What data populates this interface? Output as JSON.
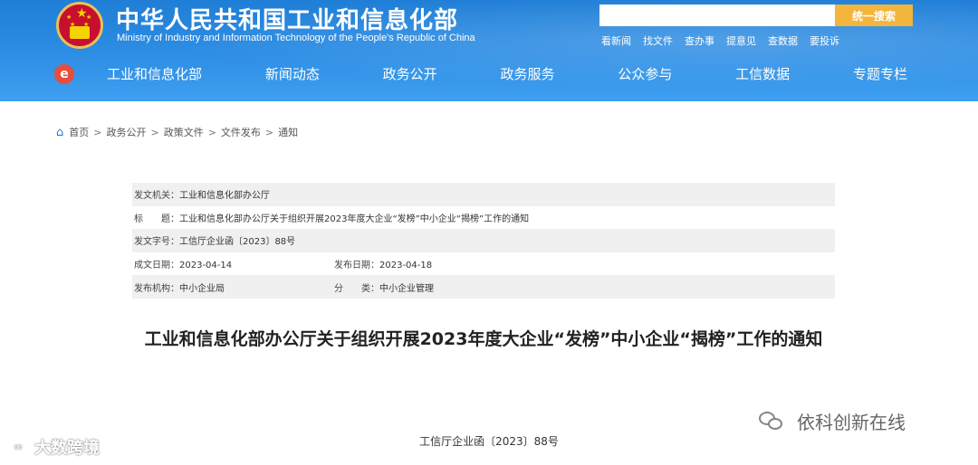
{
  "header": {
    "title_cn": "中华人民共和国工业和信息化部",
    "title_en": "Ministry of Industry and Information Technology of the People's Republic of China",
    "search_placeholder": "",
    "search_button": "统一搜索",
    "quicklinks": [
      "看新闻",
      "找文件",
      "查办事",
      "提意见",
      "查数据",
      "要投诉"
    ],
    "nav_logo": "e",
    "nav": [
      "工业和信息化部",
      "新闻动态",
      "政务公开",
      "政务服务",
      "公众参与",
      "工信数据",
      "专题专栏"
    ],
    "accent_color": "#2d8ee5"
  },
  "breadcrumb": {
    "items": [
      "首页",
      "政务公开",
      "政策文件",
      "文件发布",
      "通知"
    ],
    "separator": ">"
  },
  "meta": {
    "issuer_label": "发文机关：",
    "issuer": "工业和信息化部办公厅",
    "title_label": "标　　题：",
    "title": "工业和信息化部办公厅关于组织开展2023年度大企业“发榜”中小企业“揭榜”工作的通知",
    "docno_label": "发文字号：",
    "docno": "工信厅企业函〔2023〕88号",
    "created_label": "成文日期：",
    "created": "2023-04-14",
    "published_label": "发布日期：",
    "published": "2023-04-18",
    "agency_label": "发布机构：",
    "agency": "中小企业局",
    "category_label": "分　　类：",
    "category": "中小企业管理"
  },
  "article": {
    "title": "工业和信息化部办公厅关于组织开展2023年度大企业“发榜”中小企业“揭榜”工作的通知",
    "doc_number": "工信厅企业函〔2023〕88号"
  },
  "watermarks": {
    "right": "依科创新在线",
    "left": "大数跨境"
  }
}
